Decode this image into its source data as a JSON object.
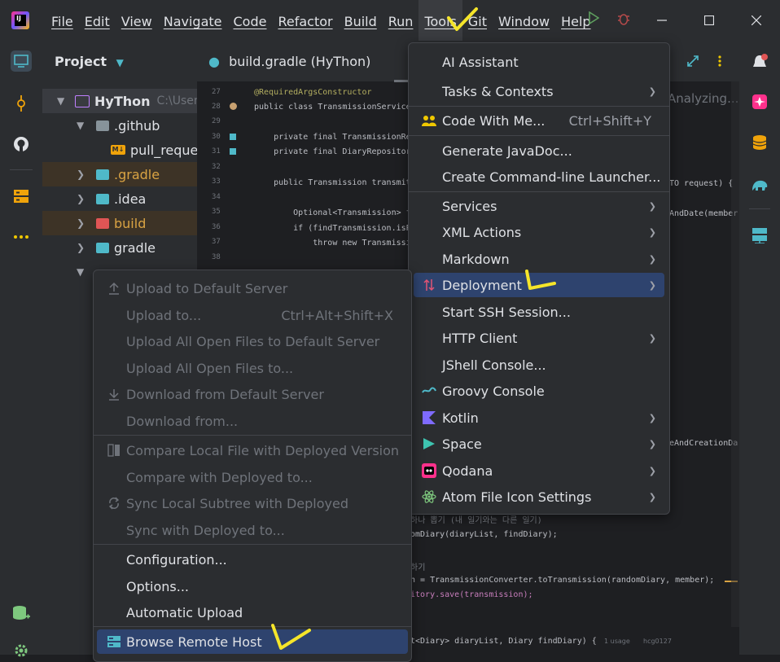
{
  "menubar": {
    "items": [
      "File",
      "Edit",
      "View",
      "Navigate",
      "Code",
      "Refactor",
      "Build",
      "Run",
      "Tools",
      "Git",
      "Window",
      "Help"
    ],
    "active": "Tools"
  },
  "project_panel": {
    "title": "Project",
    "tree": [
      {
        "name": "HyThon",
        "path": "C:\\User",
        "level": 0,
        "expanded": true
      },
      {
        "name": ".github",
        "level": 1,
        "expanded": true
      },
      {
        "name": "pull_reques",
        "level": 2
      },
      {
        "name": ".gradle",
        "level": 1,
        "expanded": false
      },
      {
        "name": ".idea",
        "level": 1,
        "expanded": false
      },
      {
        "name": "build",
        "level": 1,
        "expanded": false
      },
      {
        "name": "gradle",
        "level": 1,
        "expanded": false
      }
    ]
  },
  "editor": {
    "tab_title": "build.gradle (HyThon)",
    "analyzing_text": "Analyzing...",
    "line_numbers": [
      "27",
      "28",
      "29",
      "30",
      "31",
      "32",
      "33",
      "34",
      "35",
      "36",
      "37",
      "38"
    ],
    "code_lines": [
      {
        "ln": "27",
        "text": "@RequiredArgsConstructor"
      },
      {
        "ln": "28",
        "text": "public class TransmissionService"
      },
      {
        "ln": "30",
        "text": "    private final TransmissionRe"
      },
      {
        "ln": "31",
        "text": "    private final DiaryRepositor"
      },
      {
        "ln": "33",
        "text": "    public Transmission transmit"
      },
      {
        "ln": "35",
        "text": "        Optional<Transmission> f"
      },
      {
        "ln": "36",
        "text": "        if (findTransmission.isP"
      },
      {
        "ln": "37",
        "text": "            throw new Transmissi"
      }
    ],
    "right_code": [
      "TO request) {",
      "AndDate(member",
      "eAndCreationDa"
    ],
    "lower_code": [
      "하나 뽑기 (내 일기와는 다른 일기)",
      "omDiary(diaryList, findDiary);",
      "하기",
      "n = TransmissionConverter.toTransmission(randomDiary, member);",
      "itory.save(transmission);",
      "t<Diary> diaryList, Diary findDiary) {"
    ],
    "usage_hint": "1 usage",
    "author_hint": "hcg0127"
  },
  "tools_menu": {
    "items": [
      {
        "label": "AI Assistant",
        "submenu": false
      },
      {
        "label": "Tasks & Contexts",
        "submenu": true
      },
      {
        "label": "Code With Me...",
        "shortcut": "Ctrl+Shift+Y",
        "icon": "people-icon"
      },
      {
        "label": "Generate JavaDoc...",
        "submenu": false
      },
      {
        "label": "Create Command-line Launcher...",
        "submenu": false
      },
      {
        "label": "Services",
        "submenu": true
      },
      {
        "label": "XML Actions",
        "submenu": true
      },
      {
        "label": "Markdown",
        "submenu": true
      },
      {
        "label": "Deployment",
        "submenu": true,
        "highlighted": true,
        "icon": "deployment-icon"
      },
      {
        "label": "Start SSH Session...",
        "submenu": false
      },
      {
        "label": "HTTP Client",
        "submenu": true
      },
      {
        "label": "JShell Console...",
        "submenu": false
      },
      {
        "label": "Groovy Console",
        "submenu": false,
        "icon": "groovy-icon"
      },
      {
        "label": "Kotlin",
        "submenu": true,
        "icon": "kotlin-icon"
      },
      {
        "label": "Space",
        "submenu": true,
        "icon": "space-icon"
      },
      {
        "label": "Qodana",
        "submenu": true,
        "icon": "qodana-icon"
      },
      {
        "label": "Atom File Icon Settings",
        "submenu": true,
        "icon": "atom-icon"
      }
    ]
  },
  "deployment_menu": {
    "items": [
      {
        "label": "Upload to Default Server",
        "enabled": false,
        "icon": "upload-icon"
      },
      {
        "label": "Upload to...",
        "shortcut": "Ctrl+Alt+Shift+X",
        "enabled": false
      },
      {
        "label": "Upload All Open Files to Default Server",
        "enabled": false
      },
      {
        "label": "Upload All Open Files to...",
        "enabled": false
      },
      {
        "label": "Download from Default Server",
        "enabled": false,
        "icon": "download-icon"
      },
      {
        "label": "Download from...",
        "enabled": false
      },
      {
        "label": "Compare Local File with Deployed Version",
        "enabled": false,
        "icon": "compare-icon"
      },
      {
        "label": "Compare with Deployed to...",
        "enabled": false
      },
      {
        "label": "Sync Local Subtree with Deployed",
        "enabled": false,
        "icon": "sync-icon"
      },
      {
        "label": "Sync with Deployed to...",
        "enabled": false
      },
      {
        "label": "Configuration...",
        "enabled": true
      },
      {
        "label": "Options...",
        "enabled": true
      },
      {
        "label": "Automatic Upload",
        "enabled": true
      },
      {
        "label": "Browse Remote Host",
        "enabled": true,
        "highlighted": true,
        "icon": "server-icon"
      }
    ]
  },
  "colors": {
    "highlight": "#2e436e",
    "annotation_mark": "#f5e52a",
    "background": "#1e1f22",
    "panel": "#2b2d30"
  }
}
